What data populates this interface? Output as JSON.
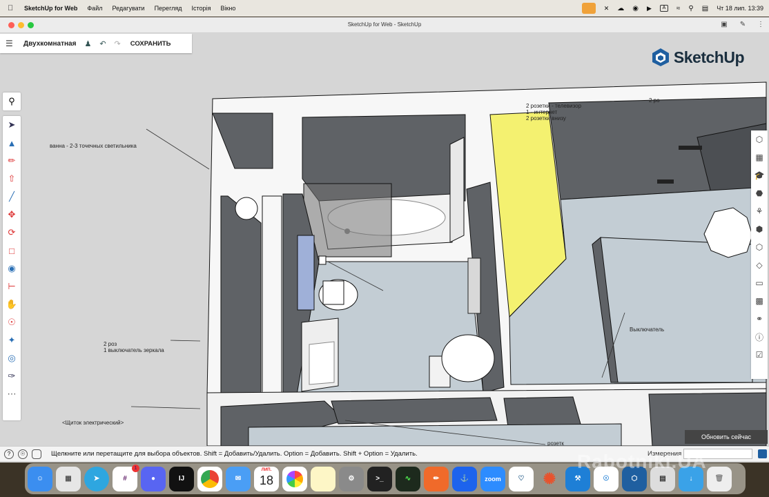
{
  "menubar": {
    "app_name": "SketchUp for Web",
    "items": [
      "Файл",
      "Редагувати",
      "Перегляд",
      "Історія",
      "Вікно"
    ],
    "status_icons": [
      "mic-icon",
      "bluetooth-off-icon",
      "cloud-icon",
      "creative-cloud-icon",
      "play-icon",
      "input-source-icon",
      "wifi-icon",
      "search-icon",
      "control-center-icon"
    ],
    "input_source": "A",
    "datetime": "Чт 18 лип.  13:39"
  },
  "window": {
    "title": "SketchUp for Web - SketchUp",
    "traffic_colors": [
      "#fe5f57",
      "#febc2e",
      "#28c840"
    ]
  },
  "toolbar": {
    "project_name": "Двухкомнатная",
    "save_label": "СОХРАНИТЬ"
  },
  "logo": {
    "text": "SketchUp",
    "color": "#1f5fa0"
  },
  "left_tools": [
    "search-icon",
    "select-icon",
    "eraser-icon",
    "pencil-icon",
    "push-pull-icon",
    "line-icon",
    "move-icon",
    "rotate-icon",
    "scale-icon",
    "paint-bucket-icon",
    "tape-measure-icon",
    "orbit-icon",
    "section-icon",
    "axes-icon",
    "compass-icon",
    "eyedropper-icon",
    "more-icon"
  ],
  "right_tools": [
    "components-icon",
    "layers-icon",
    "styles-icon",
    "materials-icon",
    "outliner-icon",
    "solid-tools-icon",
    "views-icon",
    "tags-icon",
    "eraser-icon",
    "scenes-icon",
    "glasses-icon",
    "info-icon",
    "instructor-icon"
  ],
  "annotations": {
    "tv": "2 розетки - телевизор\n1 - интернет\n2 розетки внизу",
    "tv_top": "2 ро",
    "bath": "ванна - 2-3 точечных светильника",
    "mirror": "2 роз\n1 выключатель зеркала",
    "switch": "Выключатель",
    "panel": "<Щиток электрический>",
    "bottom": "розетк"
  },
  "update_button": "Обновить сейчас",
  "statusbar": {
    "hint": "Щелкните или перетащите для выбора объектов. Shift = Добавить/Удалить. Option = Добавить. Shift + Option = Удалить.",
    "measurements_label": "Измерения"
  },
  "dock": {
    "apps": [
      "finder-icon",
      "launchpad-icon",
      "telegram-icon",
      "slack-icon",
      "discord-icon",
      "intellij-icon",
      "chrome-icon",
      "mail-icon",
      "calendar-icon",
      "photos-icon",
      "notes-icon",
      "system-settings-icon",
      "terminal-icon",
      "activity-monitor-icon",
      "pencil-app-icon",
      "docker-icon",
      "zoom-icon",
      "postgres-icon",
      "git-icon",
      "xcode-icon",
      "safari-icon",
      "sketchup-icon",
      "preview-icon",
      "downloads-icon",
      "trash-icon"
    ],
    "slack_badge": "1",
    "calendar_month": "ЛИП.",
    "calendar_day": "18",
    "zoom_label": "zoom"
  },
  "watermark": "Rabotniki.UA",
  "colors": {
    "wall_top": "#f7f7f7",
    "wall_side": "#5f6266",
    "floor": "#c3cdd4",
    "yellow": "#f4f170",
    "glass": "#7a7a7a"
  }
}
